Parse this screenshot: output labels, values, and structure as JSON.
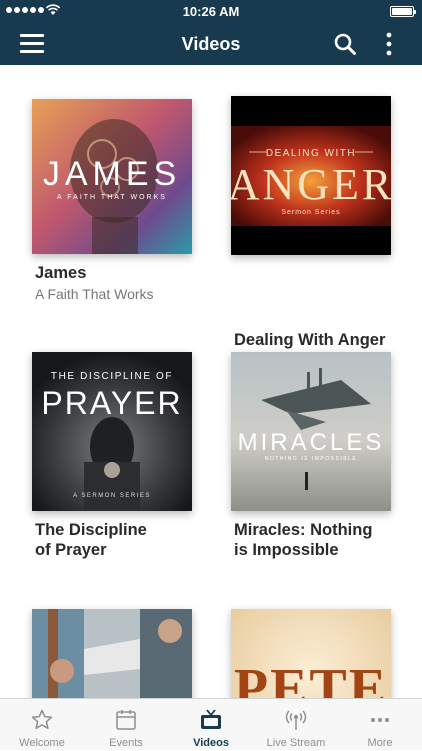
{
  "status_bar": {
    "time": "10:26 AM"
  },
  "nav": {
    "title": "Videos"
  },
  "videos": [
    {
      "title": "James",
      "subtitle": "A Faith That Works",
      "thumb_title": "JAMES",
      "thumb_subtitle": "A FAITH THAT WORKS"
    },
    {
      "title": "Dealing With Anger",
      "thumb_title": "ANGER",
      "thumb_top": "DEALING WITH",
      "thumb_subtitle": "Sermon Series"
    },
    {
      "title_line1": "The Discipline",
      "title_line2": "of Prayer",
      "thumb_top": "THE DISCIPLINE OF",
      "thumb_title": "PRAYER",
      "thumb_subtitle": "A SERMON SERIES"
    },
    {
      "title_line1": "Miracles: Nothing",
      "title_line2": "is Impossible",
      "thumb_title": "MIRACLES",
      "thumb_subtitle": "NOTHING IS IMPOSSIBLE"
    },
    {
      "thumb_title": ""
    },
    {
      "thumb_title": "PETE"
    }
  ],
  "tabs": [
    {
      "label": "Welcome",
      "icon": "star-icon"
    },
    {
      "label": "Events",
      "icon": "calendar-icon"
    },
    {
      "label": "Videos",
      "icon": "tv-icon",
      "active": true
    },
    {
      "label": "Live Stream",
      "icon": "broadcast-icon"
    },
    {
      "label": "More",
      "icon": "ellipsis-icon"
    }
  ],
  "colors": {
    "nav_bg": "#173a4f",
    "active_tab": "#173a4f",
    "inactive_tab": "#8e8e8e"
  }
}
